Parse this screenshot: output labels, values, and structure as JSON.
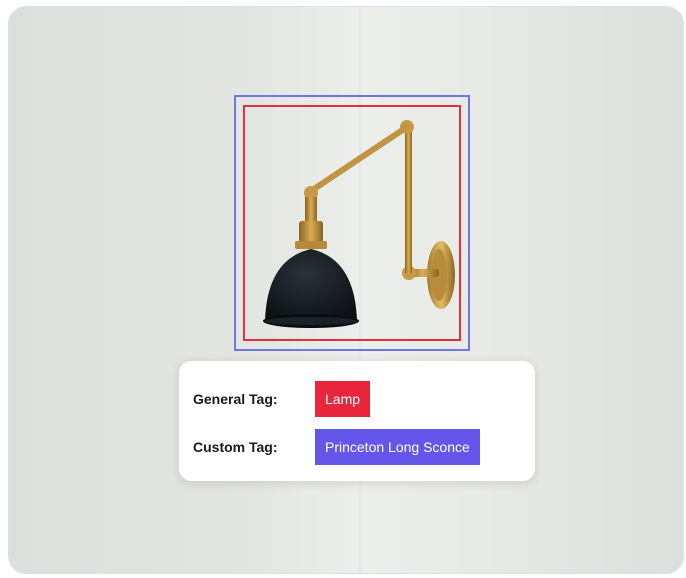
{
  "tags": {
    "general_label": "General Tag:",
    "general_value": "Lamp",
    "custom_label": "Custom Tag:",
    "custom_value": "Princeton Long Sconce"
  },
  "colors": {
    "general_box": "#e0303f",
    "custom_box": "#6f74e6",
    "general_chip": "#e8253a",
    "custom_chip": "#6456ea"
  },
  "icons": {
    "product": "wall-sconce-lamp"
  }
}
